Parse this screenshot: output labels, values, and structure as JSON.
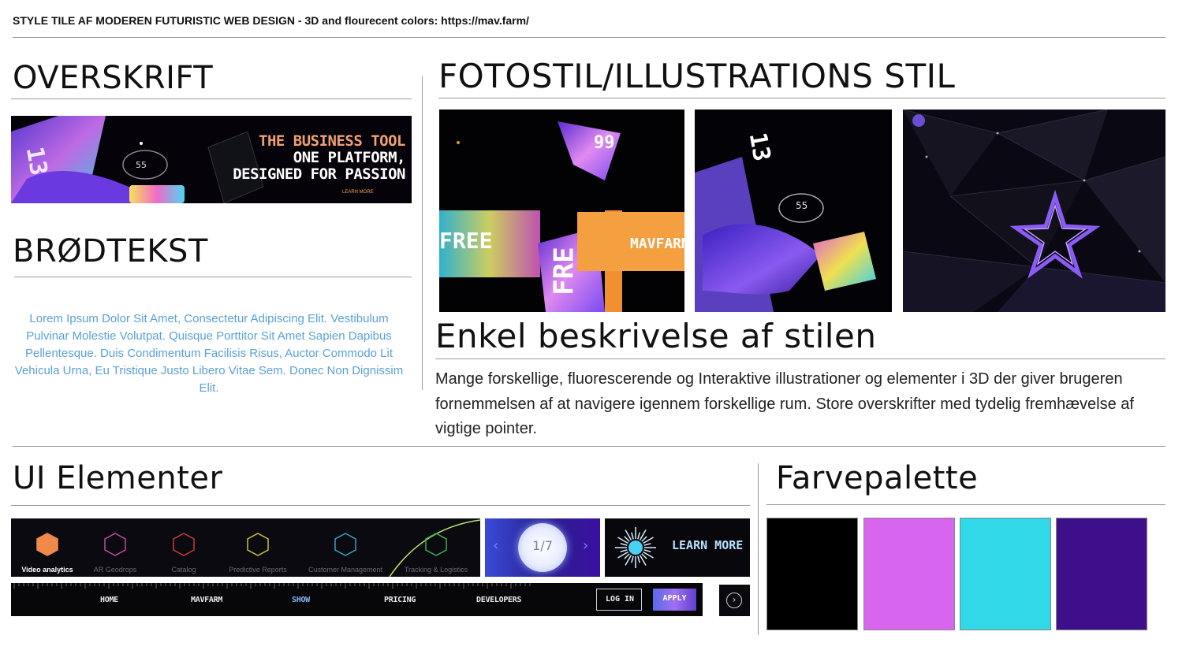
{
  "top_title": "STYLE TILE AF MODEREN FUTURISTIC WEB DESIGN - 3D and flourecent colors: https://mav.farm/",
  "sections": {
    "heading": "OVERSKRIFT",
    "body_text": "BRØDTEKST",
    "photo_style": "FOTOSTIL/ILLUSTRATIONS STIL",
    "description_heading": "Enkel beskrivelse af stilen",
    "ui_elements": "UI Elementer",
    "palette": "Farvepalette"
  },
  "banner": {
    "line1": "THE BUSINESS TOOL",
    "line2": "ONE PLATFORM,",
    "line3": "DESIGNED FOR PASSION",
    "small": "LEARN MORE",
    "badge": "55",
    "large_num": "13"
  },
  "lorem": "Lorem Ipsum Dolor Sit Amet, Consectetur Adipiscing Elit. Vestibulum Pulvinar Molestie Volutpat. Quisque Porttitor Sit Amet Sapien Dapibus Pellentesque. Duis Condimentum Facilisis Risus, Auctor Commodo Lit Vehicula Urna, Eu Tristique Justo Libero Vitae Sem. Donec Non Dignissim Elit.",
  "description": "Mange forskellige, fluorescerende og Interaktive illustrationer og elementer i 3D der giver brugeren fornemmelsen af at navigere igennem forskellige rum. Store overskrifter med tydelig fremhævelse af vigtige pointer.",
  "photos": {
    "p1_tag": "99",
    "p1_words": [
      "FREE",
      "FRE",
      "MAVFARM"
    ],
    "p2_big": "13",
    "p2_badge": "55"
  },
  "ui": {
    "menu": [
      {
        "label": "Video analytics",
        "color": "#f08a4b"
      },
      {
        "label": "AR Geodrops",
        "color": "#c04a9a"
      },
      {
        "label": "Catalog",
        "color": "#c83a3a"
      },
      {
        "label": "Predictive Reports",
        "color": "#c8c040"
      },
      {
        "label": "Customer Management",
        "color": "#3aa0c0"
      },
      {
        "label": "Tracking & Logistics",
        "color": "#3ab050"
      }
    ],
    "pager": "1/7",
    "learn_more": "LEARN MORE",
    "nav": [
      "HOME",
      "MAVFARM",
      "SHOW",
      "PRICING",
      "DEVELOPERS"
    ],
    "login": "LOG IN",
    "apply": "APPLY"
  },
  "palette_colors": [
    "#000000",
    "#d865ee",
    "#30d8e8",
    "#3e0f8a"
  ]
}
